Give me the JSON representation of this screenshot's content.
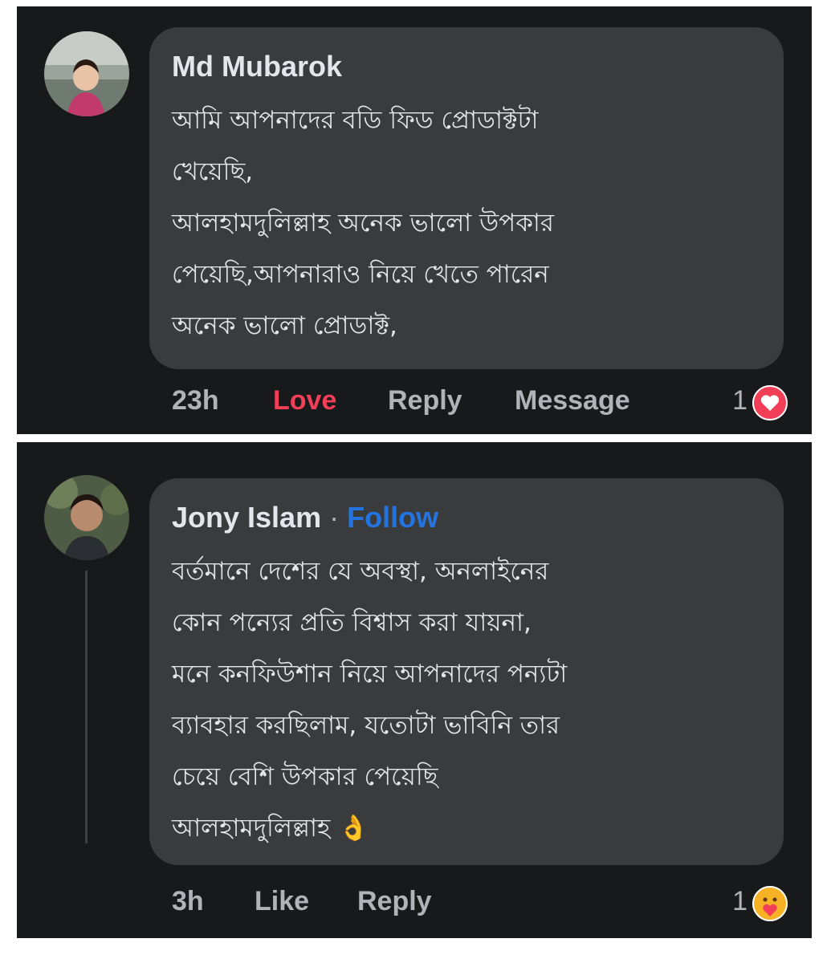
{
  "comments": [
    {
      "author": "Md Mubarok",
      "lines": [
        "আমি আপনাদের বডি ফিড প্রোডাক্টটা",
        "খেয়েছি,",
        "আলহামদুলিল্লাহ অনেক ভালো উপকার",
        "পেয়েছি,আপনারাও নিয়ে খেতে পারেন",
        "অনেক ভালো প্রোডাক্ট,"
      ],
      "time": "23h",
      "actions": [
        "Love",
        "Reply",
        "Message"
      ],
      "reaction_count": "1",
      "reaction_icon": "heart-icon",
      "reaction_color": "#f33e58",
      "love_active_color": "#f33e58"
    },
    {
      "author": "Jony Islam",
      "separator": " · ",
      "follow_label": "Follow",
      "lines": [
        "বর্তমানে দেশের যে অবস্থা, অনলাইনের",
        "কোন পন্যের প্রতি বিশ্বাস করা যায়না,",
        "মনে কনফিউশান নিয়ে আপনাদের পন্যটা",
        "ব্যাবহার করছিলাম, যতোটা ভাবিনি তার",
        "চেয়ে বেশি উপকার পেয়েছি",
        "আলহামদুলিল্লাহ 👌"
      ],
      "time": "3h",
      "actions": [
        "Like",
        "Reply"
      ],
      "reaction_count": "1",
      "reaction_icon": "care-icon",
      "reaction_color": "#f7b125"
    }
  ],
  "colors": {
    "panel_bg": "#18191a",
    "bubble_bg": "#3a3b3c",
    "text_primary": "#e4e6eb",
    "text_secondary": "#b0b3b8",
    "link_blue": "#2374e1"
  }
}
